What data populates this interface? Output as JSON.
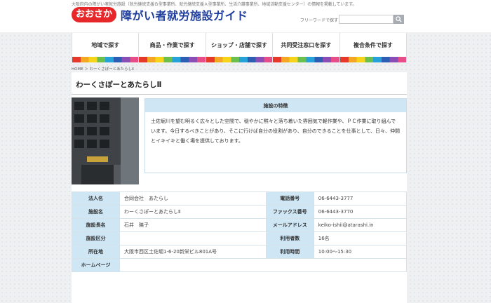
{
  "header": {
    "top_note": "大阪府内の障がい者就労施設（就労継続支援Ｂ型事業所、就労継続支援Ａ型事業所、生活介護事業所、地域活動支援センター）の情報を掲載しています。",
    "logo_badge": "おおさか",
    "logo_text": "障がい者就労施設ガイド",
    "search_label": "フリーワードで探す",
    "search_value": "",
    "search_icon": "search-icon"
  },
  "nav": [
    {
      "label": "地域で探す"
    },
    {
      "label": "商品・作業で探す"
    },
    {
      "label": "ショップ・店舗で探す"
    },
    {
      "label": "共同受注窓口を探す"
    },
    {
      "label": "複合条件で探す"
    }
  ],
  "breadcrumb": "HOME ＞ わーくさぽーとあたらしⅡ",
  "page_title": "わーくさぽーとあたらしⅡ",
  "feature": {
    "heading": "施設の特徴",
    "body": "土佐堀川を望む明るく広々とした空間で、穏やかに黙々と落ち着いた雰囲気で軽作業や、ＰＣ作業に取り組んでいます。今日するべきことがあり、そこに行けば自分の役割があり、自分のできることを仕事として、日々、仲間とイキイキと働く場を提供しております。"
  },
  "info": [
    {
      "k1": "法人名",
      "v1": "合同会社　あたらし",
      "k2": "電話番号",
      "v2": "06-6443-3777"
    },
    {
      "k1": "施設名",
      "v1": "わーくさぽーとあたらしⅡ",
      "k2": "ファックス番号",
      "v2": "06-6443-3770"
    },
    {
      "k1": "施設長名",
      "v1": "石井　暁子",
      "k2": "メールアドレス",
      "v2": "keiko-ishii@atarashi.in"
    },
    {
      "k1": "施設区分",
      "v1": "",
      "k2": "利用者数",
      "v2": "16名"
    },
    {
      "k1": "所在地",
      "v1": "大阪市西区土佐堀1-6-20新栄ビル801A号",
      "k2": "利用時間",
      "v2": "10:00～15:30"
    },
    {
      "k1": "ホームページ",
      "v1": ""
    }
  ]
}
